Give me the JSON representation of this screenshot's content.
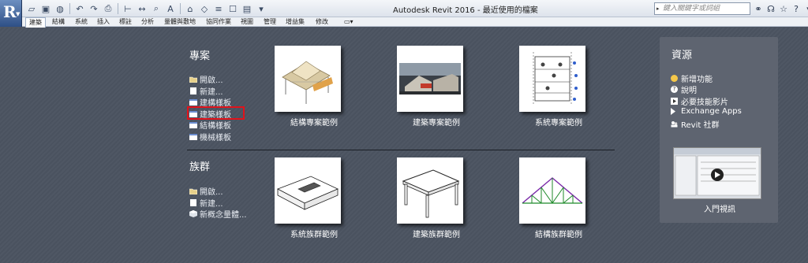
{
  "window": {
    "title": "Autodesk Revit 2016 -    最近使用的檔案",
    "search_placeholder": "鍵入關鍵字或詞組"
  },
  "ribbon_tabs": [
    {
      "label": "建築",
      "active": true
    },
    {
      "label": "結構"
    },
    {
      "label": "系統"
    },
    {
      "label": "插入"
    },
    {
      "label": "標註"
    },
    {
      "label": "分析"
    },
    {
      "label": "量體與敷地"
    },
    {
      "label": "協同作業"
    },
    {
      "label": "視圖"
    },
    {
      "label": "管理"
    },
    {
      "label": "增益集"
    },
    {
      "label": "修改"
    }
  ],
  "projects": {
    "title": "專案",
    "links": [
      {
        "label": "開啟...",
        "icon": "folder-open-icon"
      },
      {
        "label": "新建...",
        "icon": "new-doc-icon"
      },
      {
        "label": "建構樣板",
        "icon": "template-icon"
      },
      {
        "label": "建築樣板",
        "icon": "template-icon",
        "highlighted": true
      },
      {
        "label": "結構樣板",
        "icon": "template-icon"
      },
      {
        "label": "機械樣板",
        "icon": "template-icon"
      }
    ],
    "cards": [
      {
        "label": "結構專案範例"
      },
      {
        "label": "建築專案範例"
      },
      {
        "label": "系統專案範例"
      }
    ]
  },
  "families": {
    "title": "族群",
    "links": [
      {
        "label": "開啟...",
        "icon": "folder-open-icon"
      },
      {
        "label": "新建...",
        "icon": "new-doc-icon"
      },
      {
        "label": "新概念量體...",
        "icon": "mass-icon"
      }
    ],
    "cards": [
      {
        "label": "系統族群範例"
      },
      {
        "label": "建築族群範例"
      },
      {
        "label": "結構族群範例"
      }
    ]
  },
  "resources": {
    "title": "資源",
    "items": [
      {
        "label": "新增功能",
        "icon": "sun-icon",
        "color": "#f5c84a"
      },
      {
        "label": "說明",
        "icon": "help-icon"
      },
      {
        "label": "必要技能影片",
        "icon": "video-icon"
      },
      {
        "label": "Exchange Apps",
        "icon": "exchange-icon"
      },
      {
        "label": "Revit 社群",
        "icon": "community-icon"
      }
    ],
    "video_caption": "入門視訊"
  },
  "colors": {
    "highlight": "#e0131b",
    "background": "#4d5562",
    "panel": "#5e6470"
  }
}
